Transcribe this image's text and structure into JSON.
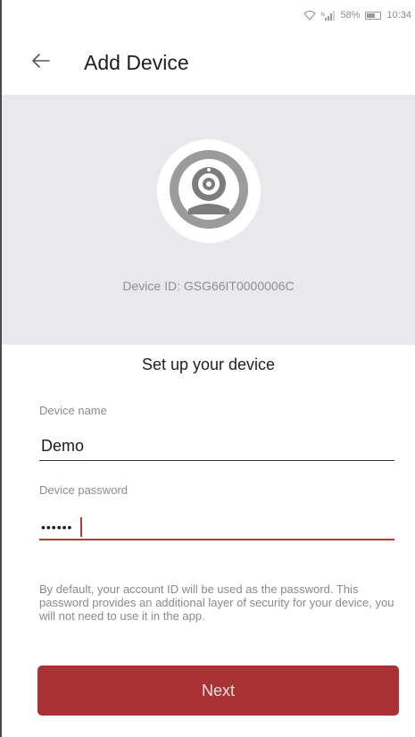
{
  "status_bar": {
    "signal_text": "ᴺ",
    "battery_percent": "58%",
    "time": "10:34"
  },
  "header": {
    "back_icon": "arrow-left-icon",
    "title": "Add Device"
  },
  "device": {
    "icon": "webcam-icon",
    "id_label": "Device ID: GSG66IT0000006C"
  },
  "form": {
    "section_title": "Set up your device",
    "name_label": "Device name",
    "name_value": "Demo",
    "password_label": "Device password",
    "password_value": "••••••",
    "help_text": "By default, your account ID will be used as the password. This password provides an additional layer of security for your device, you will not need to use it in the app."
  },
  "actions": {
    "next_label": "Next"
  },
  "colors": {
    "accent": "#a83234",
    "hero_bg": "#e9e9eb",
    "focus_line": "#b23a3a"
  }
}
